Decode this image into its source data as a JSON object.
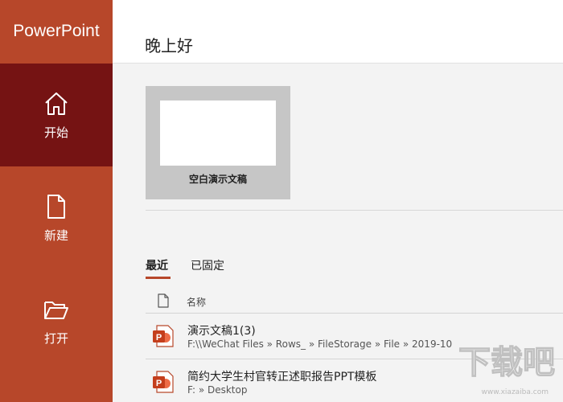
{
  "app": {
    "title": "PowerPoint"
  },
  "sidebar": {
    "items": [
      {
        "label": "开始",
        "icon": "home-icon",
        "active": true
      },
      {
        "label": "新建",
        "icon": "new-document-icon",
        "active": false
      },
      {
        "label": "打开",
        "icon": "open-folder-icon",
        "active": false
      }
    ]
  },
  "main": {
    "greeting": "晚上好",
    "template": {
      "label": "空白演示文稿"
    },
    "tabs": [
      {
        "label": "最近",
        "active": true
      },
      {
        "label": "已固定",
        "active": false
      }
    ],
    "columns": {
      "name": "名称",
      "icon": "file-icon"
    },
    "files": [
      {
        "name": "演示文稿1(3)",
        "path": "F:\\\\WeChat Files » Rows_ » FileStorage » File » 2019-10",
        "icon": "powerpoint-file-icon"
      },
      {
        "name": "简约大学生村官转正述职报告PPT模板",
        "path": "F: » Desktop",
        "icon": "powerpoint-file-icon"
      }
    ]
  },
  "watermark": {
    "text": "下载吧",
    "site": "www.xiazaiba.com"
  },
  "colors": {
    "sidebar": "#b7472a",
    "sidebar_active": "#751313",
    "accent": "#b7472a"
  }
}
